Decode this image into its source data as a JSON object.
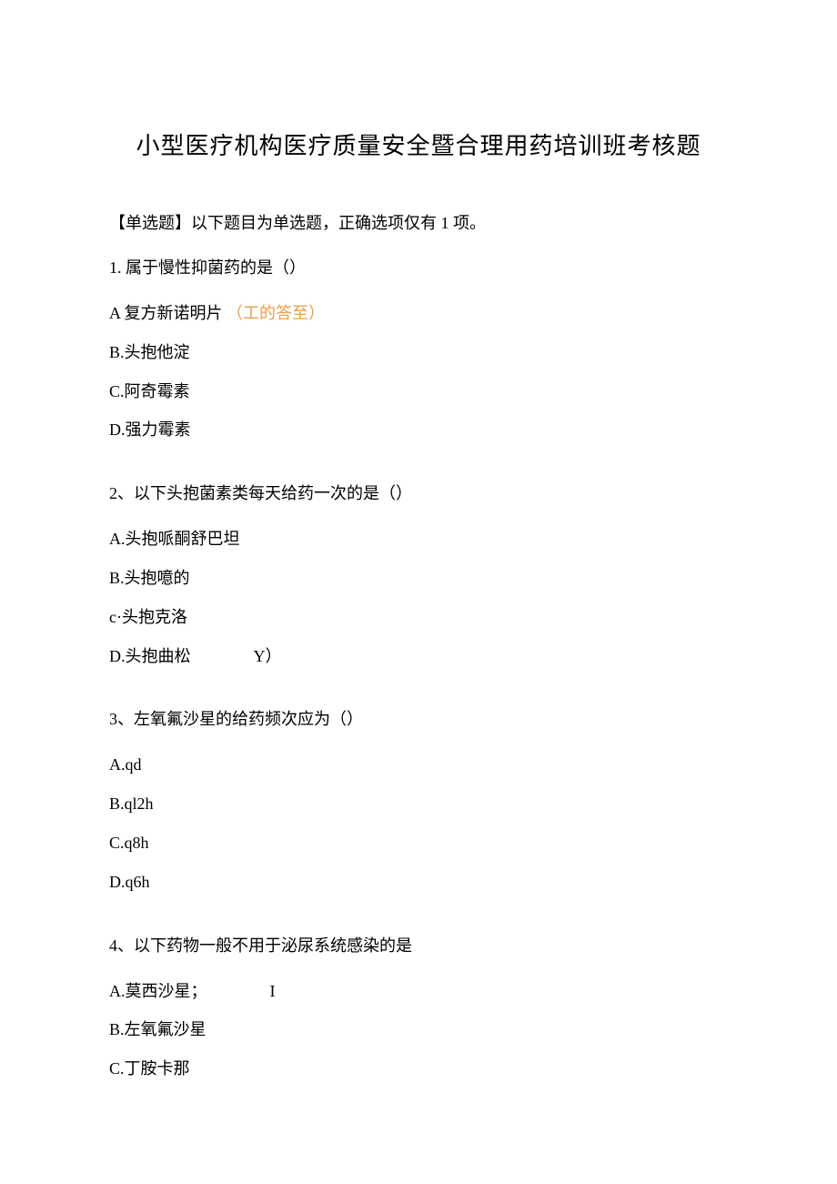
{
  "title": "小型医疗机构医疗质量安全暨合理用药培训班考核题",
  "instruction": "【单选题】以下题目为单选题，正确选项仅有 1 项。",
  "questions": [
    {
      "stem": "1. 属于慢性抑菌药的是（）",
      "options": [
        {
          "label": "A 复方新诺明片",
          "annotation": "（工的答至）"
        },
        {
          "label": "B.头抱他淀"
        },
        {
          "label": "C.阿奇霉素"
        },
        {
          "label": "D.强力霉素"
        }
      ]
    },
    {
      "stem": "2、以下头抱菌素类每天给药一次的是（）",
      "options": [
        {
          "label": "A.头抱哌酮舒巴坦"
        },
        {
          "label": "B.头抱噫的"
        },
        {
          "label": "c·头抱克洛"
        },
        {
          "label": "D.头抱曲松",
          "suffix": "Y）"
        }
      ]
    },
    {
      "stem": "3、左氧氟沙星的给药频次应为（）",
      "options": [
        {
          "label": "A.qd"
        },
        {
          "label": "B.ql2h"
        },
        {
          "label": "C.q8h"
        },
        {
          "label": "D.q6h"
        }
      ]
    },
    {
      "stem": "4、以下药物一般不用于泌尿系统感染的是",
      "options": [
        {
          "label": "A.莫西沙星；",
          "suffix": "I"
        },
        {
          "label": "B.左氧氟沙星"
        },
        {
          "label": "C.丁胺卡那"
        }
      ]
    }
  ]
}
